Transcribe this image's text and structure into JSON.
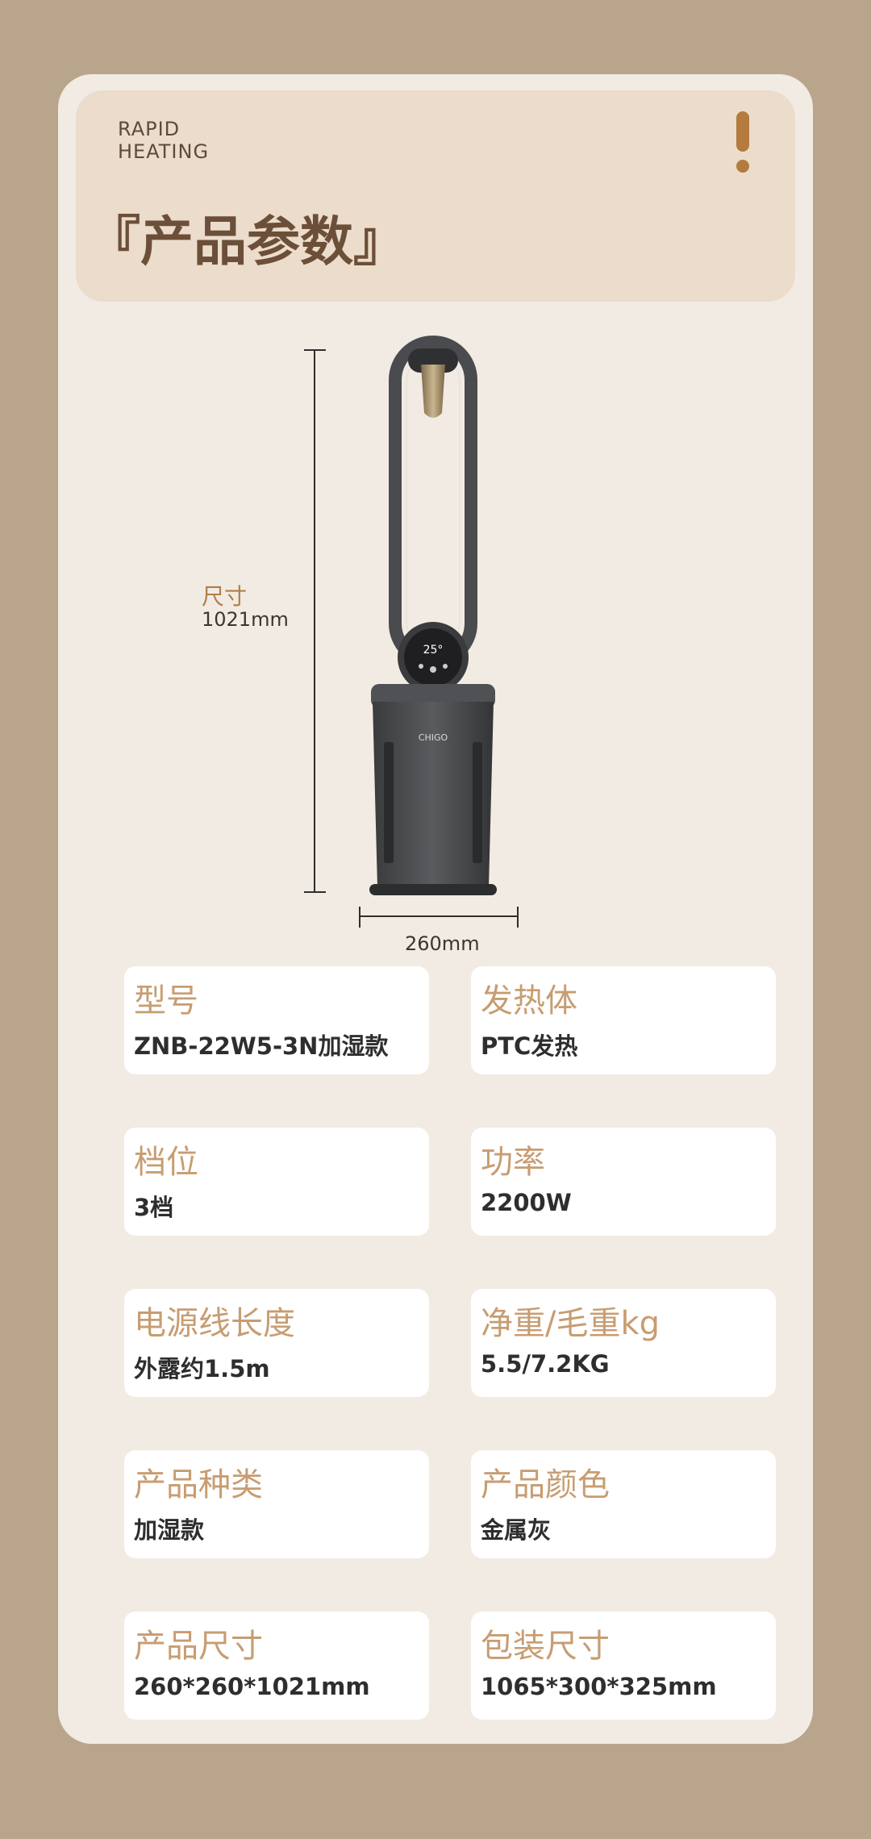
{
  "header": {
    "eng_line1": "RAPID",
    "eng_line2": "HEATING",
    "title": "『产品参数』"
  },
  "dimensions": {
    "height_label": "尺寸",
    "height_value": "1021mm",
    "width_value": "260mm"
  },
  "product": {
    "display_value": "25°",
    "brand_text": "CHIGO"
  },
  "specs": [
    {
      "label": "型号",
      "value": "ZNB-22W5-3N加湿款"
    },
    {
      "label": "发热体",
      "value": "PTC发热"
    },
    {
      "label": "档位",
      "value": "3档"
    },
    {
      "label": "功率",
      "value": "2200W"
    },
    {
      "label": "电源线长度",
      "value": "外露约1.5m"
    },
    {
      "label": "净重/毛重kg",
      "value": "5.5/7.2KG"
    },
    {
      "label": "产品种类",
      "value": "加湿款"
    },
    {
      "label": "产品颜色",
      "value": "金属灰"
    },
    {
      "label": "产品尺寸",
      "value": "260*260*1021mm"
    },
    {
      "label": "包装尺寸",
      "value": "1065*300*325mm"
    }
  ],
  "colors": {
    "page_bg": "#b8a58c",
    "card_bg": "#f2ebe3",
    "header_bg": "#ebdccc",
    "accent": "#b47a3e",
    "label": "#c79d72"
  }
}
